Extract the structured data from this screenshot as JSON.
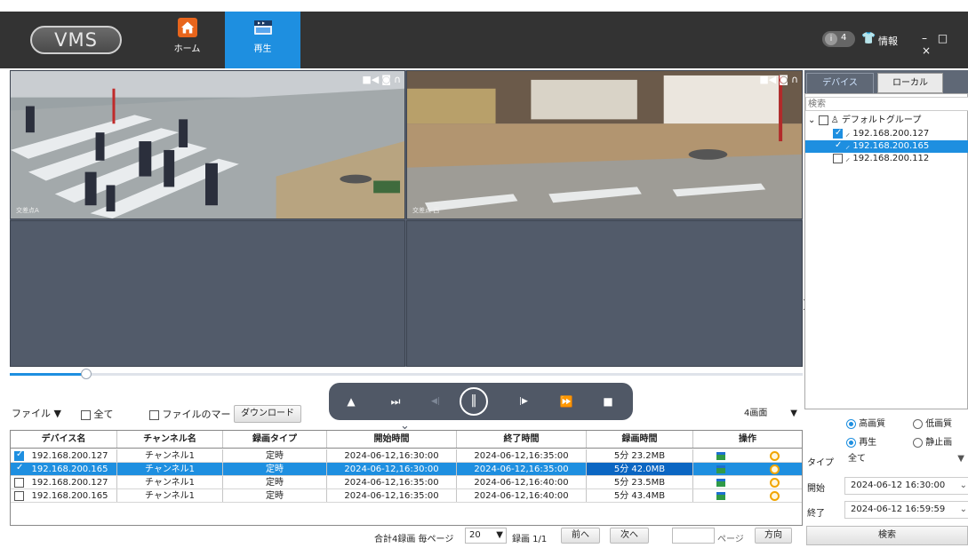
{
  "app": {
    "logo": "VMS"
  },
  "nav": {
    "home_label": "ホーム",
    "play_label": "再生"
  },
  "top_right": {
    "badge_icon": "i",
    "badge_count": "4",
    "info_label": "情報",
    "window_controls": "– □ ×"
  },
  "panes": [
    {
      "label": "交差点A",
      "icons": [
        "camera-icon",
        "snapshot-icon",
        "audio-icon"
      ]
    },
    {
      "label": "交差点 西",
      "icons": [
        "camera-icon",
        "snapshot-icon",
        "audio-icon"
      ]
    },
    {
      "label": ""
    },
    {
      "label": ""
    }
  ],
  "slider": {
    "progress": 0.096
  },
  "controls": {
    "file_dd": "ファイル",
    "all_label": "全て",
    "file_mark_label": "ファイルのマー",
    "download_label": "ダウンロード",
    "split_label": "4画面"
  },
  "playbar": {
    "eject": "▲",
    "skip": "⏭",
    "step_back": "◀|",
    "pause": "‖",
    "step_fwd": "|▶",
    "fast": "⏩",
    "stop": "■"
  },
  "table": {
    "headers": [
      "デバイス名",
      "チャンネル名",
      "録画タイプ",
      "開始時間",
      "終了時間",
      "録画時間",
      "操作"
    ],
    "rows": [
      {
        "checked": true,
        "device": "192.168.200.127",
        "channel": "チャンネル1",
        "type": "定時",
        "start": "2024-06-12,16:30:00",
        "end": "2024-06-12,16:35:00",
        "duration": "5分 23.2MB",
        "selected": false
      },
      {
        "checked": true,
        "device": "192.168.200.165",
        "channel": "チャンネル1",
        "type": "定時",
        "start": "2024-06-12,16:30:00",
        "end": "2024-06-12,16:35:00",
        "duration": "5分 42.0MB",
        "selected": true
      },
      {
        "checked": false,
        "device": "192.168.200.127",
        "channel": "チャンネル1",
        "type": "定時",
        "start": "2024-06-12,16:35:00",
        "end": "2024-06-12,16:40:00",
        "duration": "5分 23.5MB",
        "selected": false
      },
      {
        "checked": false,
        "device": "192.168.200.165",
        "channel": "チャンネル1",
        "type": "定時",
        "start": "2024-06-12,16:35:00",
        "end": "2024-06-12,16:40:00",
        "duration": "5分 43.4MB",
        "selected": false
      }
    ]
  },
  "footer": {
    "summary": "合計4録画 毎ページ",
    "per_page": "20",
    "page_info": "録画 1/1",
    "prev": "前へ",
    "next": "次へ",
    "page_label": "ページ",
    "go": "方向"
  },
  "right_panel": {
    "tab_device": "デバイス",
    "tab_local": "ローカル",
    "search_placeholder": "検索",
    "group": "デフォルトグループ",
    "devices": [
      {
        "ip": "192.168.200.127",
        "checked": true,
        "selected": false
      },
      {
        "ip": "192.168.200.165",
        "checked": true,
        "selected": true
      },
      {
        "ip": "192.168.200.112",
        "checked": false,
        "selected": false
      }
    ],
    "quality_high": "高画質",
    "quality_low": "低画質",
    "mode_play": "再生",
    "mode_still": "静止画",
    "type_label": "タイプ",
    "type_value": "全て",
    "start_label": "開始",
    "start_value": "2024-06-12 16:30:00",
    "end_label": "終了",
    "end_value": "2024-06-12 16:59:59",
    "search_button": "検索"
  },
  "colors": {
    "accent": "#1e8fe0",
    "topbar": "#333333",
    "video_bg": "#525b6a"
  }
}
